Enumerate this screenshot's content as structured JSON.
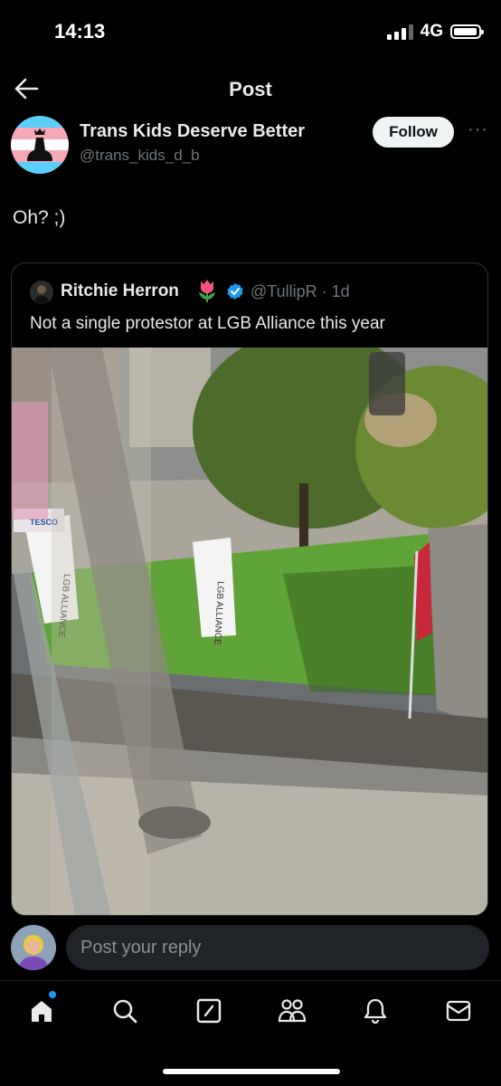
{
  "status_bar": {
    "time": "14:13",
    "network": "4G",
    "battery_level": 0.95
  },
  "header": {
    "title": "Post",
    "back_icon": "arrow-left-icon"
  },
  "post": {
    "author_name": "Trans Kids Deserve Better",
    "author_handle": "@trans_kids_d_b",
    "follow_label": "Follow",
    "more_label": "···",
    "text": "Oh? ;)"
  },
  "quoted_post": {
    "author_name": "Ritchie Herron",
    "author_emoji": "tulip-icon",
    "verified_icon": "verified-badge-icon",
    "handle_time": "@TullipR · 1d",
    "text": "Not a single protestor at LGB Alliance this year",
    "photo_banner_text": "LGB ALLIANCE",
    "photo_shop_sign": "TESCO"
  },
  "reply": {
    "placeholder": "Post your reply"
  },
  "tabbar": {
    "items": [
      "home-icon",
      "search-icon",
      "compose-icon",
      "communities-icon",
      "notifications-icon",
      "messages-icon"
    ],
    "accent": "#1d9bf0"
  }
}
